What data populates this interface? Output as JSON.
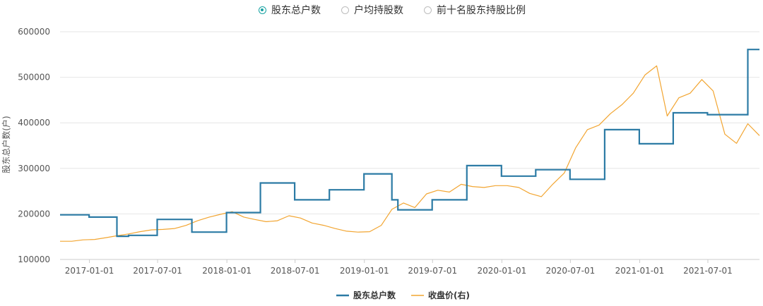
{
  "tabs": [
    {
      "label": "股东总户数",
      "active": true
    },
    {
      "label": "户均持股数",
      "active": false
    },
    {
      "label": "前十名股东持股比例",
      "active": false
    }
  ],
  "colors": {
    "accent": "#17a2a2",
    "holders": "#2c7ba5",
    "price": "#f2a531",
    "grid": "#e6e6e6",
    "text": "#555555"
  },
  "chart_data": {
    "type": "line",
    "ylabel": "股东总户数(户)",
    "ylim": [
      100000,
      600000
    ],
    "yticks": [
      100000,
      200000,
      300000,
      400000,
      500000,
      600000
    ],
    "ytick_labels": [
      "100000",
      "200000",
      "300000",
      "400000",
      "500000",
      "600000"
    ],
    "xlim": [
      "2016-10-15",
      "2021-11-15"
    ],
    "xticks": [
      "2017-01-01",
      "2017-07-01",
      "2018-01-01",
      "2018-07-01",
      "2019-01-01",
      "2019-07-01",
      "2020-01-01",
      "2020-07-01",
      "2021-01-01",
      "2021-07-01"
    ],
    "grid": true,
    "legend_position": "bottom-center",
    "series": [
      {
        "name": "股东总户数",
        "style": "step",
        "points": [
          [
            "2016-10-15",
            198000
          ],
          [
            "2016-12-31",
            193000
          ],
          [
            "2017-03-15",
            151000
          ],
          [
            "2017-04-15",
            153000
          ],
          [
            "2017-06-30",
            188000
          ],
          [
            "2017-09-30",
            160000
          ],
          [
            "2017-12-31",
            203000
          ],
          [
            "2018-03-31",
            268000
          ],
          [
            "2018-06-30",
            231000
          ],
          [
            "2018-09-30",
            253000
          ],
          [
            "2018-12-31",
            288000
          ],
          [
            "2019-03-15",
            231000
          ],
          [
            "2019-03-31",
            209000
          ],
          [
            "2019-06-30",
            231000
          ],
          [
            "2019-09-30",
            306000
          ],
          [
            "2019-12-31",
            283000
          ],
          [
            "2020-03-31",
            297000
          ],
          [
            "2020-06-30",
            276000
          ],
          [
            "2020-09-30",
            385000
          ],
          [
            "2020-12-31",
            354000
          ],
          [
            "2021-03-31",
            422000
          ],
          [
            "2021-06-30",
            418000
          ],
          [
            "2021-10-15",
            561000
          ],
          [
            "2021-11-15",
            561000
          ]
        ]
      },
      {
        "name": "收盘价(右)",
        "style": "line",
        "points": [
          [
            "2016-10-15",
            140000
          ],
          [
            "2016-11-15",
            140000
          ],
          [
            "2016-12-15",
            143000
          ],
          [
            "2017-01-15",
            144000
          ],
          [
            "2017-02-15",
            148000
          ],
          [
            "2017-03-15",
            152000
          ],
          [
            "2017-04-15",
            156000
          ],
          [
            "2017-05-15",
            161000
          ],
          [
            "2017-06-15",
            165000
          ],
          [
            "2017-07-15",
            166000
          ],
          [
            "2017-08-15",
            168000
          ],
          [
            "2017-09-15",
            175000
          ],
          [
            "2017-10-15",
            185000
          ],
          [
            "2017-11-15",
            193000
          ],
          [
            "2017-12-15",
            199000
          ],
          [
            "2018-01-15",
            205000
          ],
          [
            "2018-02-15",
            193000
          ],
          [
            "2018-03-15",
            188000
          ],
          [
            "2018-04-15",
            183000
          ],
          [
            "2018-05-15",
            185000
          ],
          [
            "2018-06-15",
            196000
          ],
          [
            "2018-07-15",
            191000
          ],
          [
            "2018-08-15",
            180000
          ],
          [
            "2018-09-15",
            175000
          ],
          [
            "2018-10-15",
            168000
          ],
          [
            "2018-11-15",
            162000
          ],
          [
            "2018-12-15",
            160000
          ],
          [
            "2019-01-15",
            161000
          ],
          [
            "2019-02-15",
            175000
          ],
          [
            "2019-03-15",
            210000
          ],
          [
            "2019-04-15",
            224000
          ],
          [
            "2019-05-15",
            214000
          ],
          [
            "2019-06-15",
            244000
          ],
          [
            "2019-07-15",
            252000
          ],
          [
            "2019-08-15",
            248000
          ],
          [
            "2019-09-15",
            265000
          ],
          [
            "2019-10-15",
            260000
          ],
          [
            "2019-11-15",
            258000
          ],
          [
            "2019-12-15",
            262000
          ],
          [
            "2020-01-15",
            262000
          ],
          [
            "2020-02-15",
            258000
          ],
          [
            "2020-03-15",
            245000
          ],
          [
            "2020-04-15",
            238000
          ],
          [
            "2020-05-15",
            265000
          ],
          [
            "2020-06-15",
            290000
          ],
          [
            "2020-07-15",
            345000
          ],
          [
            "2020-08-15",
            385000
          ],
          [
            "2020-09-15",
            395000
          ],
          [
            "2020-10-15",
            420000
          ],
          [
            "2020-11-15",
            440000
          ],
          [
            "2020-12-15",
            465000
          ],
          [
            "2021-01-15",
            505000
          ],
          [
            "2021-02-15",
            525000
          ],
          [
            "2021-03-15",
            415000
          ],
          [
            "2021-04-15",
            455000
          ],
          [
            "2021-05-15",
            465000
          ],
          [
            "2021-06-15",
            495000
          ],
          [
            "2021-07-15",
            470000
          ],
          [
            "2021-08-15",
            375000
          ],
          [
            "2021-09-15",
            355000
          ],
          [
            "2021-10-15",
            398000
          ],
          [
            "2021-11-15",
            372000
          ]
        ]
      }
    ]
  }
}
